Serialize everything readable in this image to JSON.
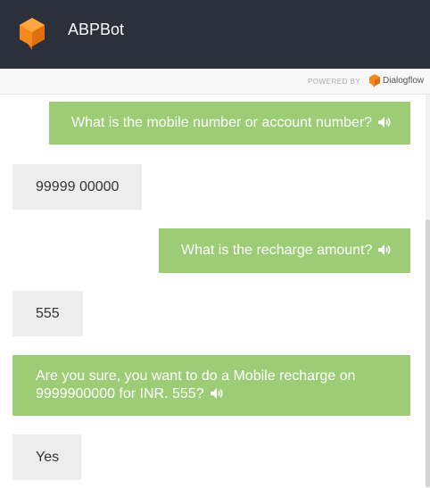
{
  "header": {
    "title": "ABPBot",
    "logo_color": "#f5891e",
    "background": "#2b303b"
  },
  "powered_by": {
    "label": "POWERED BY",
    "brand": "Dialogflow"
  },
  "messages": [
    {
      "from": "bot",
      "text": "What is the mobile number or account number?",
      "icon": "speaker-icon"
    },
    {
      "from": "user",
      "text": "99999 00000"
    },
    {
      "from": "bot",
      "text": "What is the recharge amount?",
      "icon": "speaker-icon"
    },
    {
      "from": "user",
      "text": "555"
    },
    {
      "from": "bot",
      "text": "Are you sure, you want to do a Mobile recharge on\n9999900000 for INR. 555?",
      "icon": "speaker-icon"
    },
    {
      "from": "user",
      "text": "Yes"
    }
  ],
  "colors": {
    "bot_bubble": "#9ccc75",
    "user_bubble": "#ededed"
  }
}
